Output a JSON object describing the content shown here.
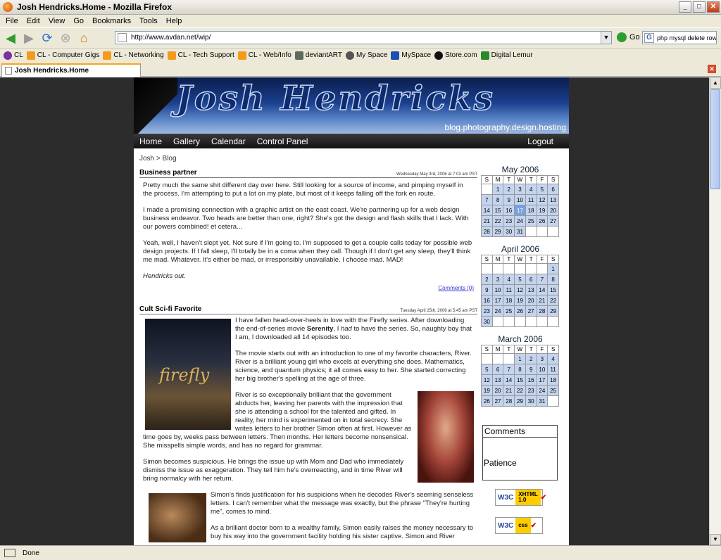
{
  "window": {
    "title": "Josh Hendricks.Home - Mozilla Firefox",
    "controls": [
      "_",
      "□",
      "✕"
    ]
  },
  "menu": [
    "File",
    "Edit",
    "View",
    "Go",
    "Bookmarks",
    "Tools",
    "Help"
  ],
  "nav": {
    "url": "http://www.avdan.net/wip/",
    "go_label": "Go",
    "search_text": "php mysql delete row"
  },
  "bookmarks": [
    "CL",
    "CL - Computer Gigs",
    "CL - Networking",
    "CL - Tech Support",
    "CL - Web/Info",
    "deviantART",
    "My Space",
    "MySpace",
    "Store.com",
    "Digital Lemur"
  ],
  "tab": {
    "label": "Josh Hendricks.Home"
  },
  "status": {
    "text": "Done"
  },
  "site": {
    "banner_title": "Josh Hendricks",
    "tagline": "blog.photography.design.hosting",
    "nav": [
      "Home",
      "Gallery",
      "Calendar",
      "Control Panel"
    ],
    "logout": "Logout",
    "breadcrumb": "Josh > Blog"
  },
  "posts": [
    {
      "title": "Business partner",
      "date": "Wednesday May 3rd, 2006 at 7:03 am PST",
      "p1": "Pretty much the same shit different day over here. Still looking for a source of income, and pimping myself in the process. I'm attempting to put a lot on my plate, but most of it keeps falling off the fork en route.",
      "p2": "I made a promising connection with a graphic artist on the east coast. We're partnering up for a web design business endeavor. Two heads are better than one, right? She's got the design and flash skills that I lack. With our powers combined! et cetera...",
      "p3": "Yeah, well, I haven't slept yet. Not sure if I'm going to. I'm supposed to get a couple calls today for possible web design projects. If I fall sleep, I'll totally be in a coma when they call. Though if I don't get any sleep, they'll think me mad. Whatever. It's either be mad, or irresponsibly unavailable. I choose mad. MAD!",
      "p4": "Hendricks out.",
      "comments": "Comments (0)"
    },
    {
      "title": "Cult Sci-fi Favorite",
      "date": "Tuesday April 25th, 2006 at 5:45 am PST",
      "p1a": "I have fallen head-over-heels in love with the Firefly series. After downloading the end-of-series movie ",
      "p1b": "Serenity",
      "p1c": ", I ",
      "p1d": "had",
      "p1e": " to have the series. So, naughty boy that I am, I downloaded all 14 episodes too.",
      "p2": "The movie starts out with an introduction to one of my favorite characters, River. River is a brilliant young girl who excels at everything she does. Mathematics, science, and quantum physics; it all comes easy to her. She started correcting her big brother's spelling at the age of three.",
      "p3": "River is so exceptionally brilliant that the government abducts her, leaving her parents with the impression that she is attending a school for the talented and gifted. In reality, her mind is experimented on in total secrecy. She writes letters to her brother Simon often at first. However as time goes by, weeks pass between letters. Then months. Her letters become nonsensical. She misspells simple words, and has no regard for grammar.",
      "p4": "Simon becomes suspicious. He brings the issue up with Mom and Dad who immediately dismiss the issue as exaggeration. They tell him he's overreacting, and in time River will bring normalcy with her return.",
      "p5": "Simon's finds justification for his suspicions when he decodes River's seeming senseless letters. I can't remember what the message was exactly, but the phrase \"They're hurting me\", comes to mind.",
      "p6": "As a brilliant doctor born to a wealthy family, Simon easily raises the money necessary to buy his way into the government facility holding his sister captive. Simon and River",
      "cover_text": "firefly"
    }
  ],
  "calendars": [
    {
      "title": "May 2006",
      "days": [
        "S",
        "M",
        "T",
        "W",
        "T",
        "F",
        "S"
      ],
      "weeks": [
        [
          "",
          "1",
          "2",
          "3",
          "4",
          "5",
          "6"
        ],
        [
          "7",
          "8",
          "9",
          "10",
          "11",
          "12",
          "13"
        ],
        [
          "14",
          "15",
          "16",
          "17",
          "18",
          "19",
          "20"
        ],
        [
          "21",
          "22",
          "23",
          "24",
          "25",
          "26",
          "27"
        ],
        [
          "28",
          "29",
          "30",
          "31",
          "",
          "",
          ""
        ]
      ],
      "today": "17"
    },
    {
      "title": "April 2006",
      "days": [
        "S",
        "M",
        "T",
        "W",
        "T",
        "F",
        "S"
      ],
      "weeks": [
        [
          "",
          "",
          "",
          "",
          "",
          "",
          "1"
        ],
        [
          "2",
          "3",
          "4",
          "5",
          "6",
          "7",
          "8"
        ],
        [
          "9",
          "10",
          "11",
          "12",
          "13",
          "14",
          "15"
        ],
        [
          "16",
          "17",
          "18",
          "19",
          "20",
          "21",
          "22"
        ],
        [
          "23",
          "24",
          "25",
          "26",
          "27",
          "28",
          "29"
        ],
        [
          "30",
          "",
          "",
          "",
          "",
          "",
          ""
        ]
      ],
      "today": ""
    },
    {
      "title": "March 2006",
      "days": [
        "S",
        "M",
        "T",
        "W",
        "T",
        "F",
        "S"
      ],
      "weeks": [
        [
          "",
          "",
          "",
          "1",
          "2",
          "3",
          "4"
        ],
        [
          "5",
          "6",
          "7",
          "8",
          "9",
          "10",
          "11"
        ],
        [
          "12",
          "13",
          "14",
          "15",
          "16",
          "17",
          "18"
        ],
        [
          "19",
          "20",
          "21",
          "22",
          "23",
          "24",
          "25"
        ],
        [
          "26",
          "27",
          "28",
          "29",
          "30",
          "31",
          ""
        ]
      ],
      "today": ""
    }
  ],
  "comments_box": {
    "title": "Comments",
    "name": "Patience"
  },
  "badges": {
    "w3c": "W3C",
    "xhtml": "XHTML",
    "xhtml_ver": "1.0",
    "css": "css"
  }
}
